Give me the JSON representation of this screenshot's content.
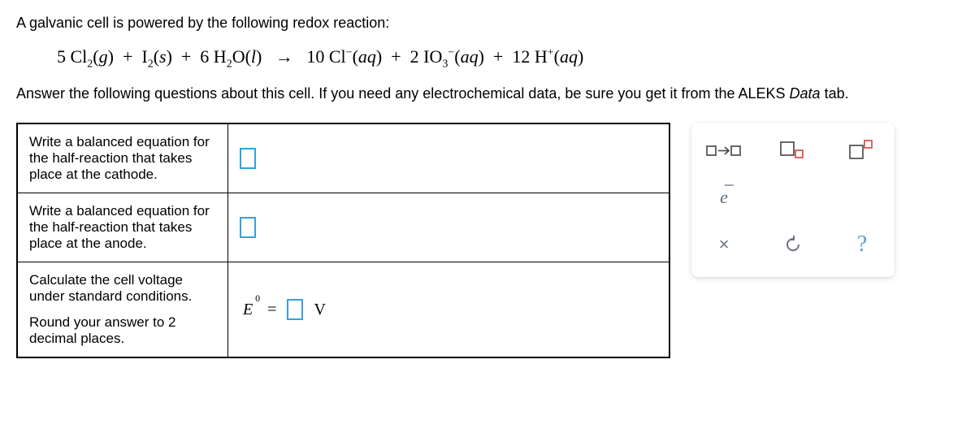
{
  "intro": "A galvanic cell is powered by the following redox reaction:",
  "equation_html": "5 Cl<sub>2</sub>(g) + I<sub>2</sub>(s) + 6 H<sub>2</sub>O(l)  →  10 Cl<sup>−</sup>(aq) + 2 IO<sub>3</sub><sup>−</sup>(aq) + 12 H<sup>+</sup>(aq)",
  "prompt_pre": "Answer the following questions about this cell. If you need any electrochemical data, be sure you get it from the ALEKS ",
  "prompt_em": "Data",
  "prompt_post": " tab.",
  "rows": {
    "cathode": "Write a balanced equation for the half-reaction that takes place at the cathode.",
    "anode": "Write a balanced equation for the half-reaction that takes place at the anode.",
    "voltage_a": "Calculate the cell voltage under standard conditions.",
    "voltage_b": "Round your answer to 2 decimal places."
  },
  "voltage": {
    "var": "E",
    "zero": "0",
    "eq": "=",
    "unit": "V"
  },
  "tools": {
    "arrowbox": "yields-tool",
    "subscript": "subscript-tool",
    "superscript": "superscript-tool",
    "electron": "e",
    "close": "×",
    "reset": "↺",
    "help": "?"
  }
}
